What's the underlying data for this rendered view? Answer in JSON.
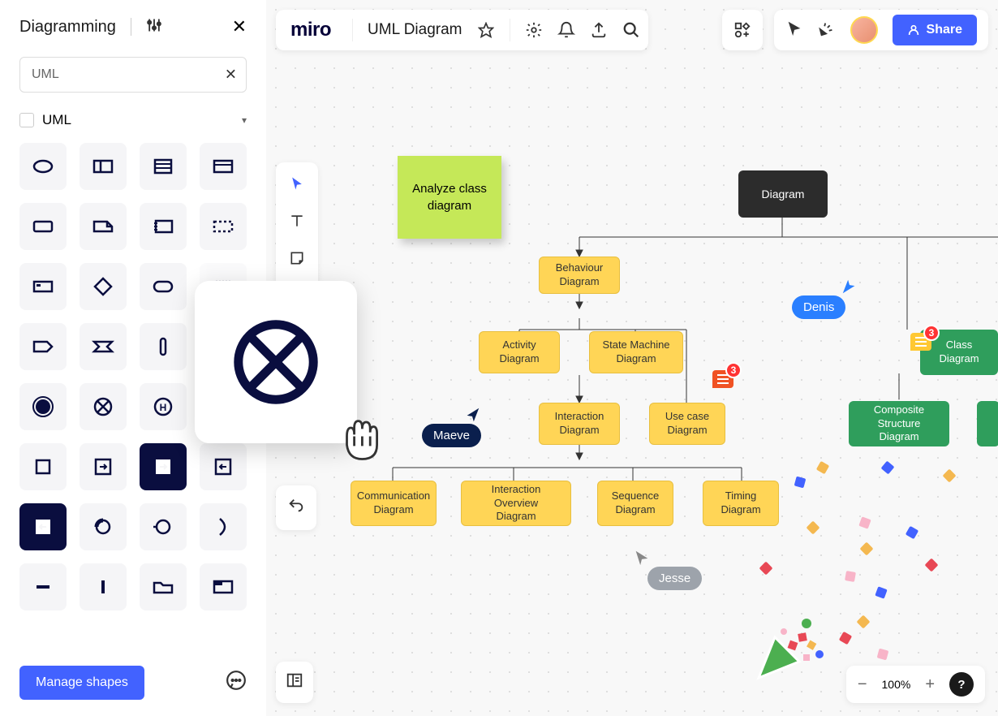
{
  "sidebar": {
    "title": "Diagramming",
    "search_value": "UML",
    "category": "UML",
    "manage_button": "Manage shapes",
    "shapes": [
      "ellipse",
      "two-col-container",
      "three-row-container",
      "top-bar-container",
      "rect",
      "folded-corner",
      "notebook",
      "dashed-rect",
      "card-thin",
      "diamond",
      "rounded-rect",
      "dashed-box",
      "tag-right",
      "tag-notch",
      "pill-vertical",
      "circle-plain",
      "filled-circle",
      "circle-cross",
      "circle-h",
      "circle-sm",
      "square",
      "square-arrow-right",
      "square-arrow-right-dark",
      "square-arrow-left",
      "square-arrow-left-dark",
      "target-half",
      "circle-dot",
      "crescent",
      "minus",
      "line-vertical",
      "folder",
      "browser"
    ]
  },
  "header": {
    "logo": "miro",
    "doc_title": "UML Diagram",
    "share_label": "Share"
  },
  "canvas": {
    "sticky_note": "Analyze class diagram",
    "nodes": {
      "diagram": "Diagram",
      "behaviour": "Behaviour Diagram",
      "activity": "Activity Diagram",
      "state_machine": "State Machine Diagram",
      "interaction": "Interaction Diagram",
      "use_case": "Use case Diagram",
      "communication": "Communication Diagram",
      "interaction_overview": "Interaction Overview Diagram",
      "sequence": "Sequence Diagram",
      "timing": "Timing Diagram",
      "class": "Class Diagram",
      "composite": "Composite Structure Diagram"
    },
    "cursors": {
      "maeve": "Maeve",
      "denis": "Denis",
      "jesse": "Jesse"
    },
    "comment_count_1": "3",
    "comment_count_2": "3"
  },
  "zoom": {
    "level": "100%"
  }
}
